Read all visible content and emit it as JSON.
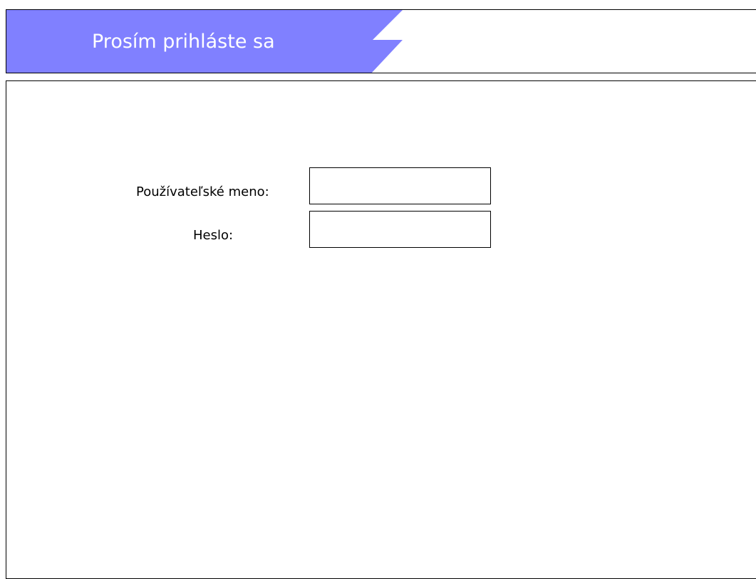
{
  "header": {
    "title": "Prosím prihláste sa",
    "accent_color": "#8080ff"
  },
  "login_form": {
    "username_label": "Používateľské meno:",
    "username_value": "",
    "password_label": "Heslo:",
    "password_value": ""
  }
}
